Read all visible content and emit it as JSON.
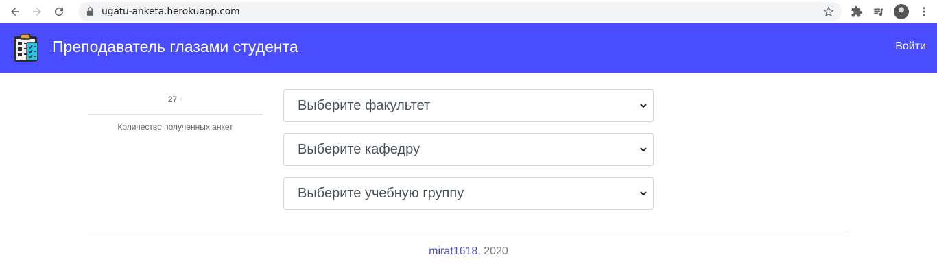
{
  "browser": {
    "url": "ugatu-anketa.herokuapp.com"
  },
  "navbar": {
    "brand": "Преподаватель глазами студента",
    "login": "Войти",
    "color": "#4a4dff"
  },
  "stats": {
    "count": "27",
    "caption": "Количество полученных анкет"
  },
  "selects": [
    {
      "placeholder": "Выберите факультет"
    },
    {
      "placeholder": "Выберите кафедру"
    },
    {
      "placeholder": "Выберите учебную группу"
    }
  ],
  "footer": {
    "author": "mirat1618",
    "year_suffix": ", 2020"
  }
}
